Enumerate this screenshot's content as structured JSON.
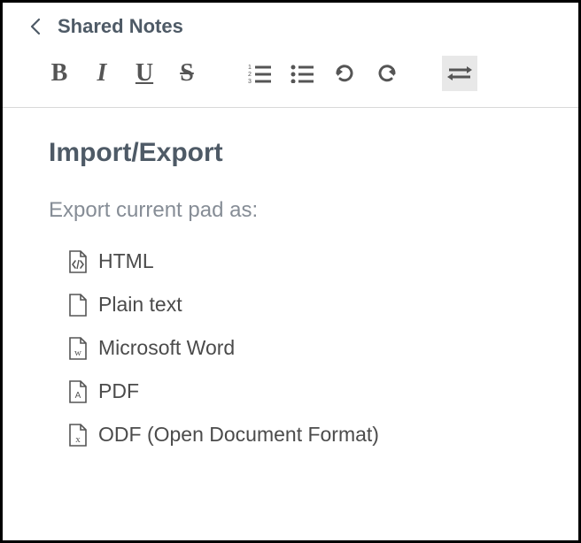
{
  "header": {
    "title": "Shared Notes"
  },
  "toolbar": {
    "bold": "B",
    "italic": "I",
    "underline": "U",
    "strike": "S"
  },
  "panel": {
    "title": "Import/Export",
    "subtitle": "Export current pad as:",
    "items": [
      {
        "label": "HTML"
      },
      {
        "label": "Plain text"
      },
      {
        "label": "Microsoft Word"
      },
      {
        "label": "PDF"
      },
      {
        "label": "ODF (Open Document Format)"
      }
    ]
  }
}
